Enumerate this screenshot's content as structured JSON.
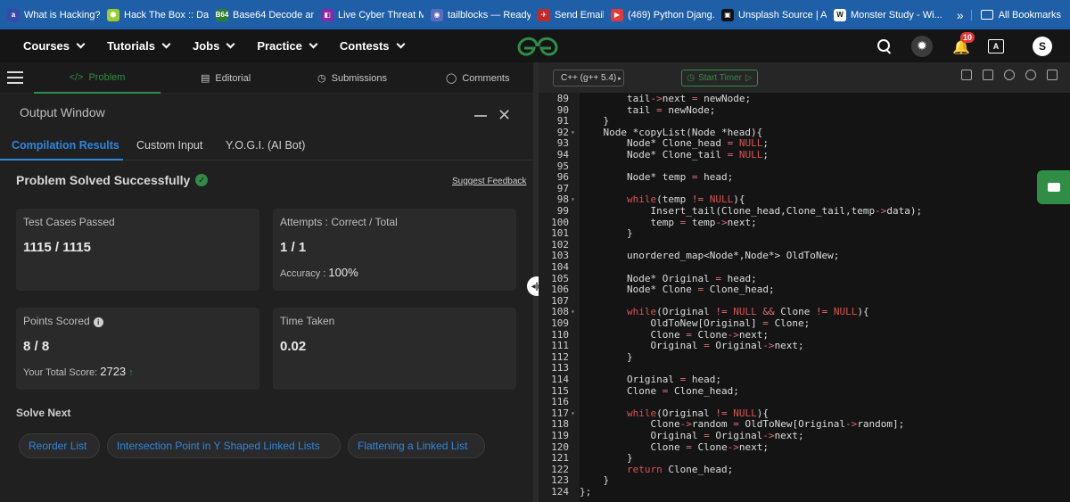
{
  "bookmarks": {
    "items": [
      {
        "label": "What is Hacking? In...",
        "color": "#3949ab",
        "glyph": "a"
      },
      {
        "label": "Hack The Box :: Das...",
        "color": "#9acd32",
        "glyph": "⬢"
      },
      {
        "label": "Base64 Decode and...",
        "color": "#2e7d32",
        "glyph": "B64"
      },
      {
        "label": "Live Cyber Threat M...",
        "color": "#8e24aa",
        "glyph": "◧"
      },
      {
        "label": "tailblocks — Ready-...",
        "color": "#5c6bc0",
        "glyph": "◉"
      },
      {
        "label": "Send Email :)",
        "color": "#c62828",
        "glyph": "✈"
      },
      {
        "label": "(469) Python Djang...",
        "color": "#e53935",
        "glyph": "▶"
      },
      {
        "label": "Unsplash Source | A...",
        "color": "#111111",
        "glyph": "▣"
      },
      {
        "label": "Monster Study - Wi...",
        "color": "#ffffff",
        "glyph": "W"
      }
    ],
    "more": "»",
    "all_label": "All Bookmarks"
  },
  "nav": {
    "items": [
      "Courses",
      "Tutorials",
      "Jobs",
      "Practice",
      "Contests"
    ],
    "notification_count": "10",
    "avatar_letter": "S",
    "translate_glyph": "A"
  },
  "tabs": {
    "problem": "Problem",
    "editorial": "Editorial",
    "submissions": "Submissions",
    "comments": "Comments"
  },
  "output": {
    "title": "Output Window",
    "result_tabs": [
      "Compilation Results",
      "Custom Input",
      "Y.O.G.I. (AI Bot)"
    ],
    "status": "Problem Solved Successfully",
    "suggest_feedback": "Suggest Feedback",
    "cards": {
      "test_cases_label": "Test Cases Passed",
      "test_cases_value": "1115 / 1115",
      "attempts_label": "Attempts : Correct / Total",
      "attempts_value": "1 / 1",
      "accuracy_label": "Accuracy :",
      "accuracy_value": "100%",
      "points_label": "Points Scored",
      "points_value": "8 / 8",
      "total_score_label": "Your Total Score:",
      "total_score_value": "2723",
      "time_label": "Time Taken",
      "time_value": "0.02"
    },
    "solve_next_label": "Solve Next",
    "solve_next": [
      "Reorder List",
      "Intersection Point in Y Shaped Linked Lists",
      "Flattening a Linked List"
    ]
  },
  "editor": {
    "language": "C++ (g++ 5.4)",
    "timer_label": "Start Timer",
    "accent_color": "#2f8d46",
    "lines": [
      {
        "n": "89",
        "fold": "",
        "text": "        tail->next = newNode;"
      },
      {
        "n": "90",
        "fold": "",
        "text": "        tail = newNode;"
      },
      {
        "n": "91",
        "fold": "",
        "text": "    }"
      },
      {
        "n": "92",
        "fold": "▾",
        "text": "    Node *copyList(Node *head){"
      },
      {
        "n": "93",
        "fold": "",
        "text": "        Node* Clone_head = NULL;"
      },
      {
        "n": "94",
        "fold": "",
        "text": "        Node* Clone_tail = NULL;"
      },
      {
        "n": "95",
        "fold": "",
        "text": ""
      },
      {
        "n": "96",
        "fold": "",
        "text": "        Node* temp = head;"
      },
      {
        "n": "97",
        "fold": "",
        "text": ""
      },
      {
        "n": "98",
        "fold": "▾",
        "text": "        while(temp != NULL){"
      },
      {
        "n": "99",
        "fold": "",
        "text": "            Insert_tail(Clone_head,Clone_tail,temp->data);"
      },
      {
        "n": "100",
        "fold": "",
        "text": "            temp = temp->next;"
      },
      {
        "n": "101",
        "fold": "",
        "text": "        }"
      },
      {
        "n": "102",
        "fold": "",
        "text": ""
      },
      {
        "n": "103",
        "fold": "",
        "text": "        unordered_map<Node*,Node*> OldToNew;"
      },
      {
        "n": "104",
        "fold": "",
        "text": ""
      },
      {
        "n": "105",
        "fold": "",
        "text": "        Node* Original = head;"
      },
      {
        "n": "106",
        "fold": "",
        "text": "        Node* Clone = Clone_head;"
      },
      {
        "n": "107",
        "fold": "",
        "text": ""
      },
      {
        "n": "108",
        "fold": "▾",
        "text": "        while(Original != NULL && Clone != NULL){"
      },
      {
        "n": "109",
        "fold": "",
        "text": "            OldToNew[Original] = Clone;"
      },
      {
        "n": "110",
        "fold": "",
        "text": "            Clone = Clone->next;"
      },
      {
        "n": "111",
        "fold": "",
        "text": "            Original = Original->next;"
      },
      {
        "n": "112",
        "fold": "",
        "text": "        }"
      },
      {
        "n": "113",
        "fold": "",
        "text": ""
      },
      {
        "n": "114",
        "fold": "",
        "text": "        Original = head;"
      },
      {
        "n": "115",
        "fold": "",
        "text": "        Clone = Clone_head;"
      },
      {
        "n": "116",
        "fold": "",
        "text": ""
      },
      {
        "n": "117",
        "fold": "▾",
        "text": "        while(Original != NULL){"
      },
      {
        "n": "118",
        "fold": "",
        "text": "            Clone->random = OldToNew[Original->random];"
      },
      {
        "n": "119",
        "fold": "",
        "text": "            Original = Original->next;"
      },
      {
        "n": "120",
        "fold": "",
        "text": "            Clone = Clone->next;"
      },
      {
        "n": "121",
        "fold": "",
        "text": "        }"
      },
      {
        "n": "122",
        "fold": "",
        "text": "        return Clone_head;"
      },
      {
        "n": "123",
        "fold": "",
        "text": "    }"
      },
      {
        "n": "124",
        "fold": "",
        "text": "};"
      }
    ]
  }
}
